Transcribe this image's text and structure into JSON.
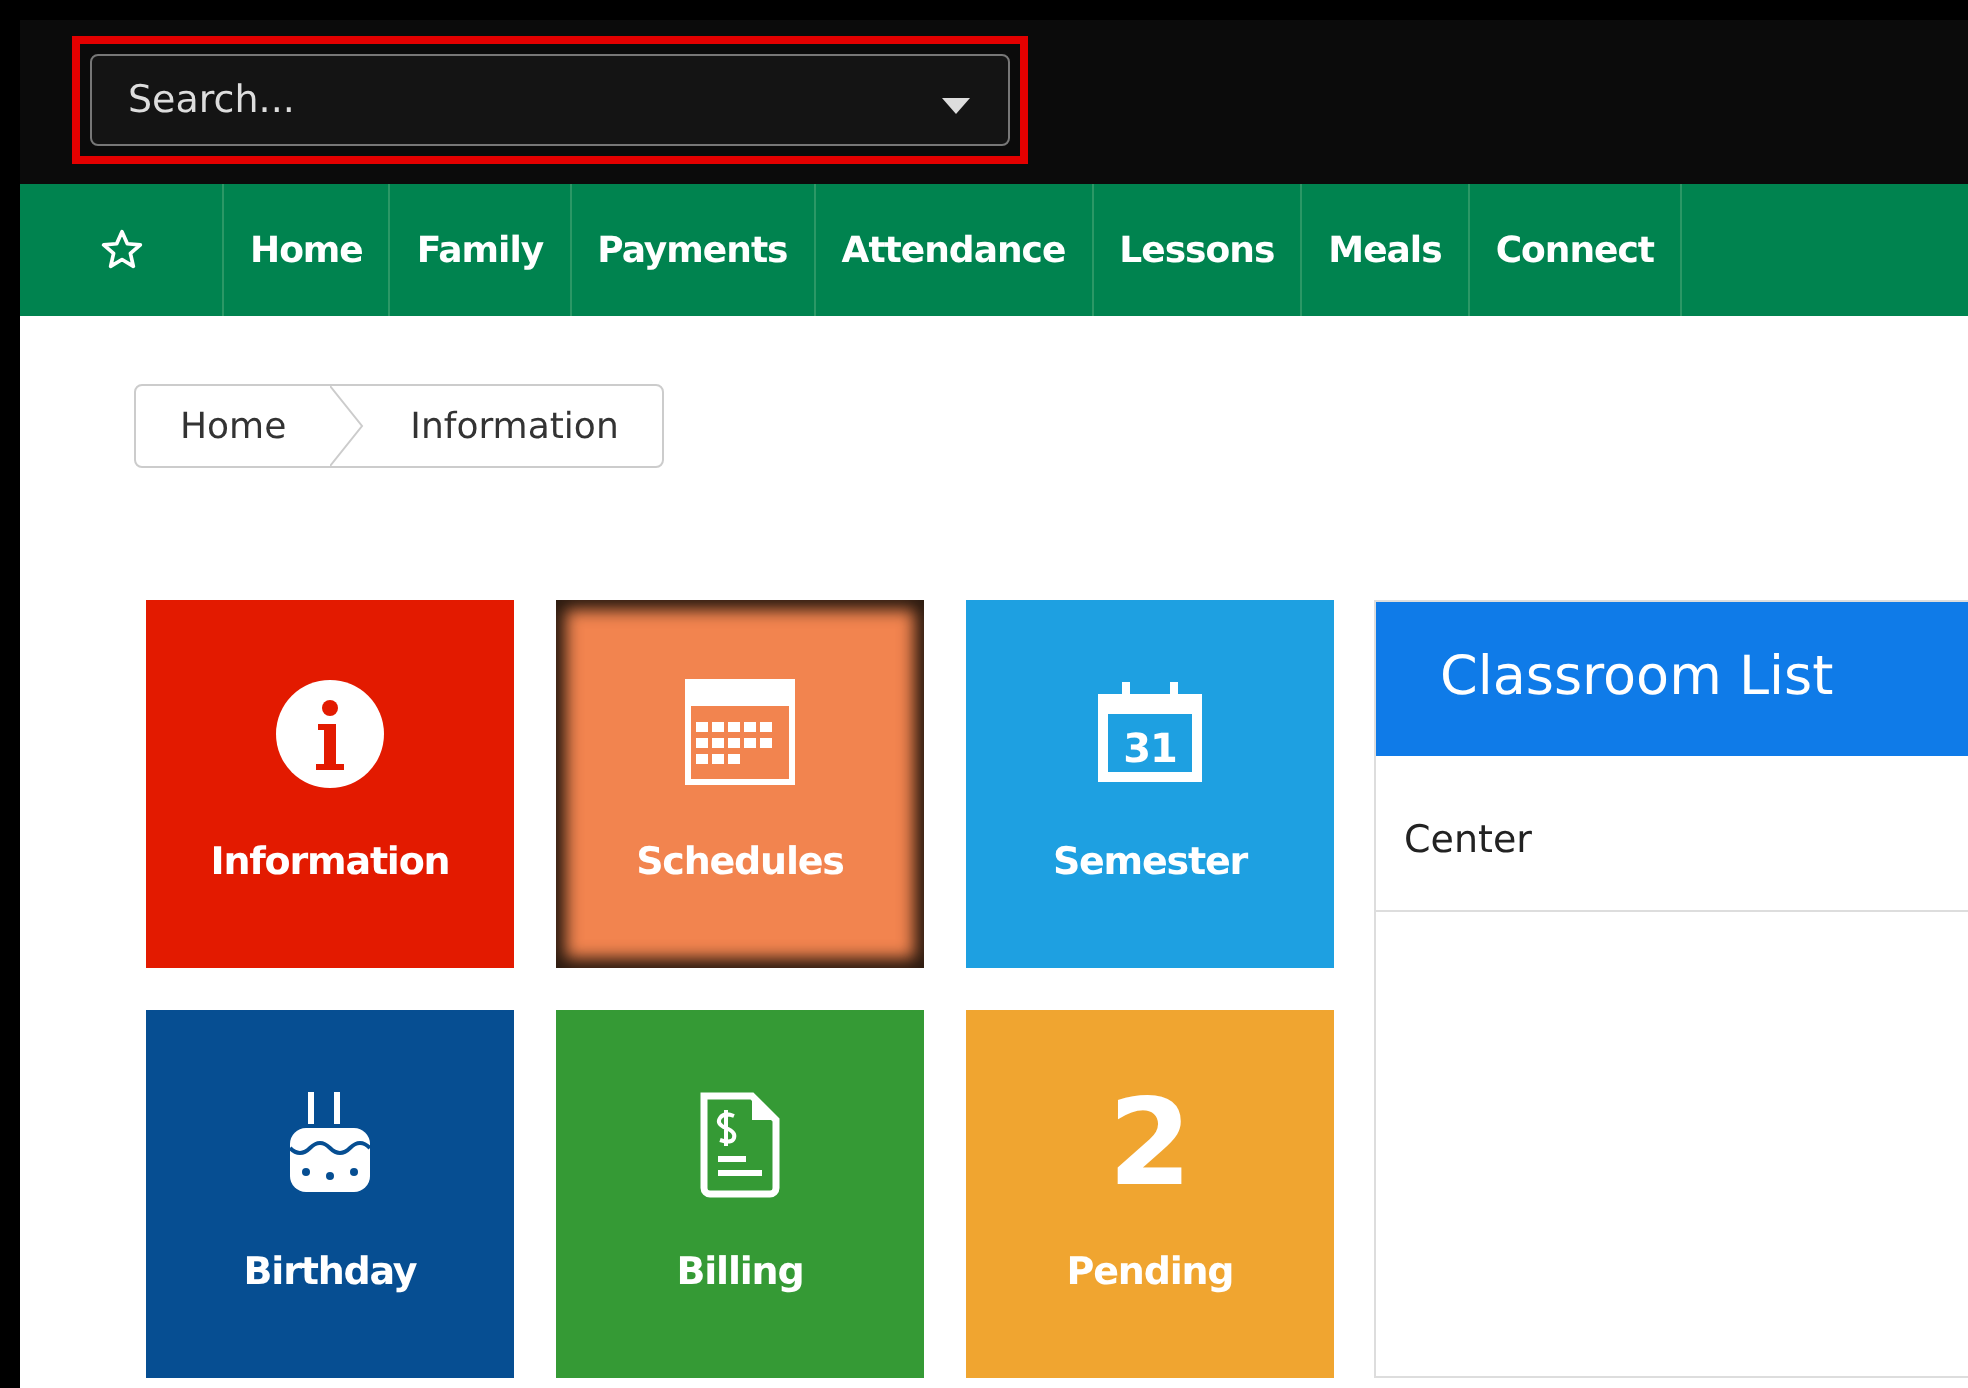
{
  "search": {
    "placeholder": "Search...",
    "highlighted": true
  },
  "nav": [
    {
      "kind": "star",
      "selected": false
    },
    {
      "label": "Home",
      "kind": "link"
    },
    {
      "label": "Family",
      "kind": "link"
    },
    {
      "label": "Payments",
      "kind": "link"
    },
    {
      "label": "Attendance",
      "kind": "link"
    },
    {
      "label": "Lessons",
      "kind": "link"
    },
    {
      "label": "Meals",
      "kind": "link"
    },
    {
      "label": "Connect",
      "kind": "link"
    }
  ],
  "breadcrumb": [
    "Home",
    "Information"
  ],
  "tiles": [
    {
      "label": "Information",
      "kind": "info",
      "color": "#e31a00",
      "selected": false
    },
    {
      "label": "Schedules",
      "kind": "schedule",
      "color": "#f2844f",
      "selected": true
    },
    {
      "label": "Semester",
      "kind": "calendar",
      "icon_text": "31",
      "color": "#1ea0e1",
      "selected": false
    },
    {
      "label": "Birthday",
      "kind": "cake",
      "color": "#064e92",
      "selected": false
    },
    {
      "label": "Billing",
      "kind": "bill",
      "color": "#359a35",
      "selected": false
    },
    {
      "label": "Pending",
      "kind": "count",
      "count": "2",
      "color": "#f0a530",
      "selected": false
    }
  ],
  "classroom_list": {
    "title": "Classroom List",
    "columns": [
      "Center"
    ]
  }
}
